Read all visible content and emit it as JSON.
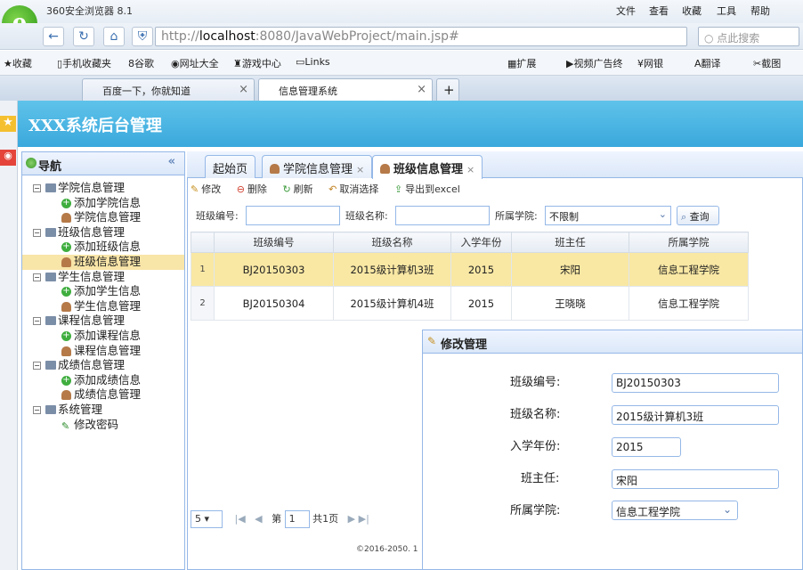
{
  "browser": {
    "title": "360安全浏览器 8.1",
    "menu": [
      "文件",
      "查看",
      "收藏",
      "工具",
      "帮助"
    ],
    "url_host": "localhost",
    "url_prefix": "http://",
    "url_rest": ":8080/JavaWebProject/main.jsp#",
    "search_placeholder": "点此搜索",
    "bookmarks": [
      "收藏",
      "手机收藏夹",
      "谷歌",
      "网址大全",
      "游戏中心",
      "Links"
    ],
    "bookmarks_right": [
      "扩展",
      "视频广告终",
      "网银",
      "翻译",
      "截图"
    ],
    "tabs": [
      {
        "label": "百度一下，你就知道",
        "active": false
      },
      {
        "label": "信息管理系统",
        "active": true
      }
    ]
  },
  "app": {
    "title": "XXX系统后台管理",
    "nav_title": "导航",
    "tree": [
      {
        "label": "学院信息管理",
        "level": 1
      },
      {
        "label": "添加学院信息",
        "level": 2,
        "icon": "add"
      },
      {
        "label": "学院信息管理",
        "level": 2,
        "icon": "user"
      },
      {
        "label": "班级信息管理",
        "level": 1
      },
      {
        "label": "添加班级信息",
        "level": 2,
        "icon": "add"
      },
      {
        "label": "班级信息管理",
        "level": 2,
        "icon": "user",
        "selected": true
      },
      {
        "label": "学生信息管理",
        "level": 1
      },
      {
        "label": "添加学生信息",
        "level": 2,
        "icon": "add"
      },
      {
        "label": "学生信息管理",
        "level": 2,
        "icon": "user"
      },
      {
        "label": "课程信息管理",
        "level": 1
      },
      {
        "label": "添加课程信息",
        "level": 2,
        "icon": "add"
      },
      {
        "label": "课程信息管理",
        "level": 2,
        "icon": "user"
      },
      {
        "label": "成绩信息管理",
        "level": 1
      },
      {
        "label": "添加成绩信息",
        "level": 2,
        "icon": "add"
      },
      {
        "label": "成绩信息管理",
        "level": 2,
        "icon": "user"
      },
      {
        "label": "系统管理",
        "level": 1
      },
      {
        "label": "修改密码",
        "level": 2,
        "icon": "pencil"
      }
    ],
    "main_tabs": [
      {
        "label": "起始页"
      },
      {
        "label": "学院信息管理"
      },
      {
        "label": "班级信息管理"
      }
    ],
    "toolbar": {
      "edit": "修改",
      "delete": "删除",
      "refresh": "刷新",
      "cancel_select": "取消选择",
      "export": "导出到excel"
    },
    "filters": {
      "class_no_label": "班级编号:",
      "class_name_label": "班级名称:",
      "college_label": "所属学院:",
      "college_value": "不限制",
      "query": "查询"
    },
    "grid": {
      "columns": [
        "班级编号",
        "班级名称",
        "入学年份",
        "班主任",
        "所属学院"
      ],
      "rows": [
        {
          "n": "1",
          "cells": [
            "BJ20150303",
            "2015级计算机3班",
            "2015",
            "宋阳",
            "信息工程学院"
          ]
        },
        {
          "n": "2",
          "cells": [
            "BJ20150304",
            "2015级计算机4班",
            "2015",
            "王晓晓",
            "信息工程学院"
          ]
        }
      ]
    },
    "pager": {
      "page_size": "5",
      "page_prefix": "第",
      "page": "1",
      "total": "共1页"
    },
    "footer": "©2016-2050. 1",
    "dialog": {
      "title": "修改管理",
      "fields": [
        {
          "label": "班级编号:",
          "value": "BJ20150303"
        },
        {
          "label": "班级名称:",
          "value": "2015级计算机3班"
        },
        {
          "label": "入学年份:",
          "value": "2015"
        },
        {
          "label": "班主任:",
          "value": "宋阳"
        },
        {
          "label": "所属学院:",
          "value": "信息工程学院"
        }
      ]
    }
  }
}
